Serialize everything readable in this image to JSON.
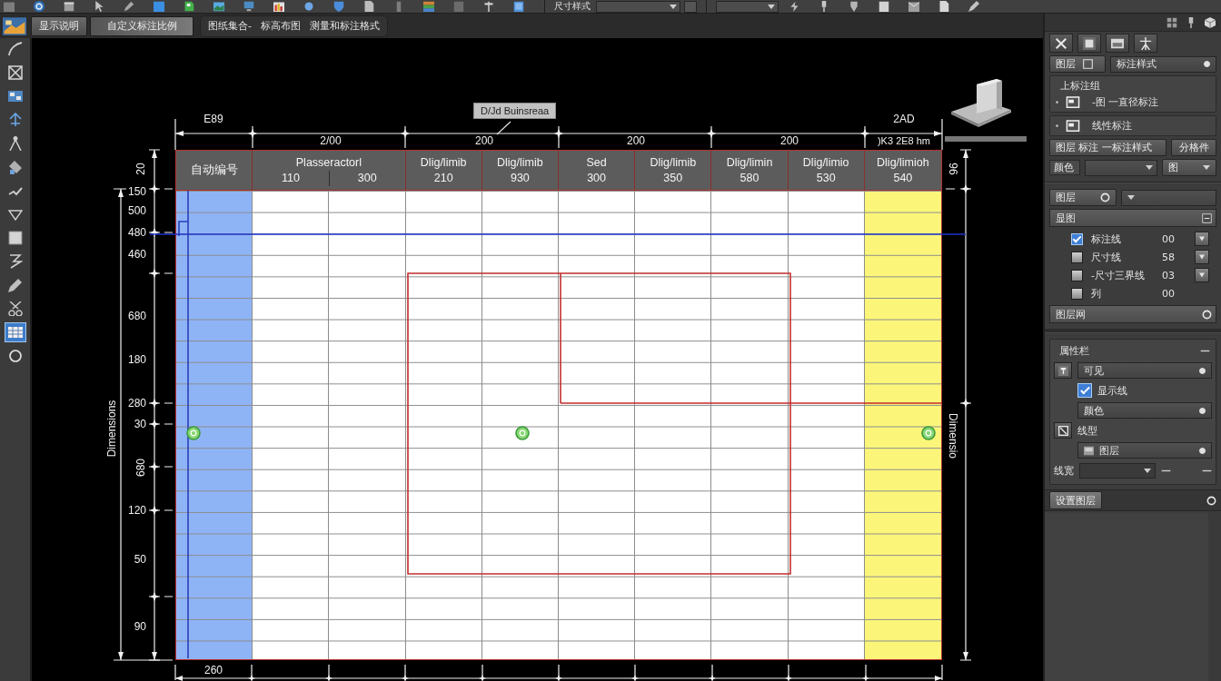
{
  "top_toolbar": {
    "style_label": "尺寸样式"
  },
  "command_bar": {
    "buttons": [
      "显示说明",
      "自定义标注比例"
    ],
    "menu": [
      "图纸集合-",
      "标高布图",
      "测量和标注格式"
    ]
  },
  "left_toolbar": {
    "tools": [
      {
        "selected": false
      },
      {
        "selected": false
      },
      {
        "selected": false
      },
      {
        "selected": false
      },
      {
        "selected": false
      },
      {
        "selected": false
      },
      {
        "selected": false
      },
      {
        "selected": false
      },
      {
        "selected": false
      },
      {
        "selected": false
      },
      {
        "selected": false
      },
      {
        "selected": false
      },
      {
        "selected": true
      },
      {
        "selected": false
      }
    ]
  },
  "drawing": {
    "note": "D/Jd Buinsreaa",
    "top_dimensions": [
      "E89",
      "2/00",
      "200",
      "200",
      "200",
      "2AD",
      ")K3 2E8 hm"
    ],
    "left_dimensions": [
      "20",
      "150",
      "500",
      "480",
      "460",
      "680",
      "180",
      "280",
      "30",
      "680",
      "120",
      "50",
      "90"
    ],
    "outer_dimension": "Dimensions",
    "right_dimensions": [
      "96",
      "Dimensio"
    ],
    "bottom_dimensions": [
      "260"
    ],
    "table": {
      "header": [
        {
          "title": "自动编号",
          "color": "#8fb4f6"
        },
        {
          "title": "Plasseractorl",
          "values": [
            "110",
            "300"
          ]
        },
        {
          "title": "Dlig/limib",
          "values": [
            "210"
          ]
        },
        {
          "title": "Dlig/limib",
          "values": [
            "930"
          ]
        },
        {
          "title": "Sed",
          "values": [
            "300"
          ]
        },
        {
          "title": "Dlig/limib",
          "values": [
            "350"
          ]
        },
        {
          "title": "Dlig/limin",
          "values": [
            "580"
          ]
        },
        {
          "title": "Dlig/limio",
          "values": [
            "530"
          ]
        },
        {
          "title": "Dlig/limioh",
          "values": [
            "540"
          ],
          "color": "#fbf67a"
        }
      ]
    }
  },
  "panel": {
    "layer_button": "图层",
    "style_select": "标注样式",
    "style_group": {
      "title": "上标注组",
      "items": [
        "-图 一直径标注",
        "线性标注"
      ]
    },
    "style_button": "图层 标注 一标注样式",
    "split_button": "分格件",
    "color_label": "颜色",
    "color_button": "图",
    "layer_toggle": "图层",
    "layers": {
      "title": "显图",
      "rows": [
        {
          "name": "标注线",
          "value": "00",
          "checked": true,
          "menu": true
        },
        {
          "name": "尺寸线",
          "value": "58",
          "checked": false,
          "menu": true
        },
        {
          "name": "-尺寸三界线",
          "value": "03",
          "checked": false,
          "menu": true
        },
        {
          "name": "列",
          "value": "00",
          "checked": false,
          "menu": false
        }
      ],
      "footer": "图层网"
    },
    "properties": {
      "title": "属性栏",
      "rows": [
        {
          "kind": "icon-select",
          "label": "可见"
        },
        {
          "kind": "check",
          "label": "显示线",
          "checked": true
        },
        {
          "kind": "select",
          "label": "颜色"
        },
        {
          "kind": "icon-label",
          "label": "线型"
        },
        {
          "kind": "swatch-select",
          "label": "图层"
        },
        {
          "kind": "input",
          "label": "线宽"
        }
      ]
    },
    "settings_button": "设置图层"
  }
}
